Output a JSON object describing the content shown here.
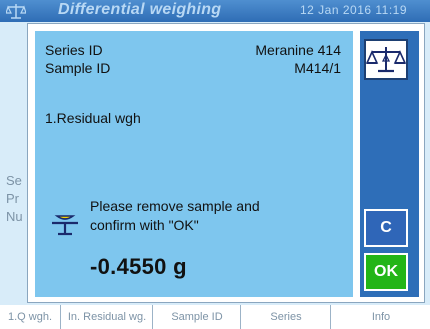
{
  "background": {
    "header_title": "Differential weighing",
    "header_date": "12 Jan 2016  11:19",
    "left_fragments": [
      "Se",
      "Pr",
      "Nu"
    ],
    "footer_keys": [
      "1.Q wgh.",
      "In. Residual wg.",
      "Sample ID",
      "Series",
      "Info"
    ]
  },
  "dialog": {
    "series_label": "Series ID",
    "series_value": "Meranine 414",
    "sample_label": "Sample ID",
    "sample_value": "M414/1",
    "step_label": "1.Residual wgh",
    "message_line1": "Please remove sample and",
    "message_line2": "confirm with \"OK\"",
    "result": "-0.4550 g"
  },
  "buttons": {
    "balance_icon": "balance-scale-icon",
    "clear_label": "C",
    "ok_label": "OK"
  },
  "colors": {
    "panel": "#7ec6ee",
    "button_bar": "#2e6eb8",
    "ok_button": "#23b517",
    "icon_yellow": "#f5d300"
  }
}
